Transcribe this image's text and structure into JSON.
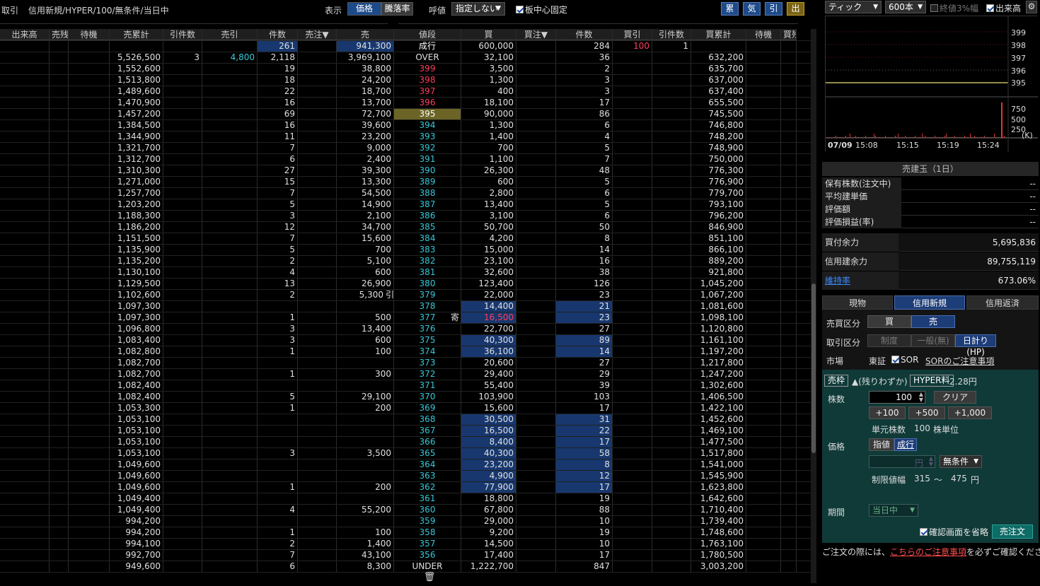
{
  "topbar": {
    "section": "取引",
    "title": "信用新規/HYPER/100/無条件/当日中",
    "display_label": "表示",
    "display_price": "価格",
    "display_rate": "騰落率",
    "tick_label": "呼値",
    "tick_value": "指定しない",
    "center_fix": "板中心固定",
    "btn_cumulative": "累",
    "btn_spirit": "気",
    "btn_pull": "引",
    "btn_exit": "出"
  },
  "book": {
    "headers": [
      "出来高",
      "売残",
      "待機",
      "売累計",
      "引件数",
      "売引",
      "件数",
      "売注▼",
      "売",
      "値段",
      "買",
      "買注▼",
      "件数",
      "買引",
      "引件数",
      "買累計",
      "待機",
      "買残"
    ],
    "summary": {
      "sell_count": "261",
      "sell_qty": "941,300",
      "price": "成行",
      "buy_qty": "600,000",
      "buy_count": "284",
      "buy_pull": "100",
      "buy_pull_count": "1"
    },
    "over": {
      "cum": "5,526,500",
      "pull_count": "3",
      "pull": "4,800",
      "count": "2,118",
      "qty": "3,969,100",
      "price": "OVER",
      "buy": "32,100",
      "bcount": "36",
      "bcum": "632,200"
    },
    "under": {
      "cum": "949,600",
      "count": "6",
      "qty": "8,300",
      "price": "UNDER",
      "buy": "1,222,700",
      "bcount": "847",
      "bcum": "3,003,200"
    },
    "rows": [
      {
        "cum": "1,552,600",
        "cnt": "19",
        "qty": "38,800",
        "p": "399",
        "b": "3,500",
        "bc": "2",
        "bcum": "635,700"
      },
      {
        "cum": "1,513,800",
        "cnt": "18",
        "qty": "24,200",
        "p": "398",
        "b": "1,300",
        "bc": "3",
        "bcum": "637,000"
      },
      {
        "cum": "1,489,600",
        "cnt": "22",
        "qty": "18,700",
        "p": "397",
        "b": "400",
        "bc": "3",
        "bcum": "637,400"
      },
      {
        "cum": "1,470,900",
        "cnt": "16",
        "qty": "13,700",
        "p": "396",
        "b": "18,100",
        "bc": "17",
        "bcum": "655,500"
      },
      {
        "cum": "1,457,200",
        "cnt": "69",
        "qty": "72,700",
        "p": "395",
        "b": "90,000",
        "bc": "86",
        "bcum": "745,500"
      },
      {
        "cum": "1,384,500",
        "cnt": "16",
        "qty": "39,600",
        "p": "394",
        "b": "1,300",
        "bc": "6",
        "bcum": "746,800"
      },
      {
        "cum": "1,344,900",
        "cnt": "11",
        "qty": "23,200",
        "p": "393",
        "b": "1,400",
        "bc": "4",
        "bcum": "748,200"
      },
      {
        "cum": "1,321,700",
        "cnt": "7",
        "qty": "9,000",
        "p": "392",
        "b": "700",
        "bc": "5",
        "bcum": "748,900"
      },
      {
        "cum": "1,312,700",
        "cnt": "6",
        "qty": "2,400",
        "p": "391",
        "b": "1,100",
        "bc": "7",
        "bcum": "750,000"
      },
      {
        "cum": "1,310,300",
        "cnt": "27",
        "qty": "39,300",
        "p": "390",
        "b": "26,300",
        "bc": "48",
        "bcum": "776,300"
      },
      {
        "cum": "1,271,000",
        "cnt": "15",
        "qty": "13,300",
        "p": "389",
        "b": "600",
        "bc": "5",
        "bcum": "776,900"
      },
      {
        "cum": "1,257,700",
        "cnt": "7",
        "qty": "54,500",
        "p": "388",
        "b": "2,800",
        "bc": "6",
        "bcum": "779,700"
      },
      {
        "cum": "1,203,200",
        "cnt": "5",
        "qty": "14,900",
        "p": "387",
        "b": "13,400",
        "bc": "5",
        "bcum": "793,100"
      },
      {
        "cum": "1,188,300",
        "cnt": "3",
        "qty": "2,100",
        "p": "386",
        "b": "3,100",
        "bc": "6",
        "bcum": "796,200"
      },
      {
        "cum": "1,186,200",
        "cnt": "12",
        "qty": "34,700",
        "p": "385",
        "b": "50,700",
        "bc": "50",
        "bcum": "846,900"
      },
      {
        "cum": "1,151,500",
        "cnt": "7",
        "qty": "15,600",
        "p": "384",
        "b": "4,200",
        "bc": "8",
        "bcum": "851,100"
      },
      {
        "cum": "1,135,900",
        "cnt": "5",
        "qty": "700",
        "p": "383",
        "b": "15,000",
        "bc": "14",
        "bcum": "866,100"
      },
      {
        "cum": "1,135,200",
        "cnt": "2",
        "qty": "5,100",
        "p": "382",
        "b": "23,100",
        "bc": "16",
        "bcum": "889,200"
      },
      {
        "cum": "1,130,100",
        "cnt": "4",
        "qty": "600",
        "p": "381",
        "b": "32,600",
        "bc": "38",
        "bcum": "921,800"
      },
      {
        "cum": "1,129,500",
        "cnt": "13",
        "qty": "26,900",
        "p": "380",
        "b": "123,400",
        "bc": "126",
        "bcum": "1,045,200"
      },
      {
        "cum": "1,102,600",
        "cnt": "2",
        "qty": "5,300",
        "mark": "引",
        "p": "379",
        "b": "22,000",
        "bc": "23",
        "bcum": "1,067,200"
      },
      {
        "cum": "1,097,300",
        "cnt": "",
        "qty": "",
        "p": "378",
        "b": "14,400",
        "bc": "21",
        "bcum": "1,081,600",
        "hl": true
      },
      {
        "cum": "1,097,300",
        "cnt": "1",
        "qty": "500",
        "p": "377",
        "bmark": "寄",
        "b": "16,500",
        "bc": "23",
        "bcum": "1,098,100",
        "hl": true,
        "bred": true
      },
      {
        "cum": "1,096,800",
        "cnt": "3",
        "qty": "13,400",
        "p": "376",
        "b": "22,700",
        "bc": "27",
        "bcum": "1,120,800"
      },
      {
        "cum": "1,083,400",
        "cnt": "3",
        "qty": "600",
        "p": "375",
        "b": "40,300",
        "bc": "89",
        "bcum": "1,161,100",
        "hl": true
      },
      {
        "cum": "1,082,800",
        "cnt": "1",
        "qty": "100",
        "p": "374",
        "b": "36,100",
        "bc": "14",
        "bcum": "1,197,200",
        "hl": true
      },
      {
        "cum": "1,082,700",
        "cnt": "",
        "qty": "",
        "p": "373",
        "b": "20,600",
        "bc": "27",
        "bcum": "1,217,800"
      },
      {
        "cum": "1,082,700",
        "cnt": "1",
        "qty": "300",
        "p": "372",
        "b": "29,400",
        "bc": "29",
        "bcum": "1,247,200"
      },
      {
        "cum": "1,082,400",
        "cnt": "",
        "qty": "",
        "p": "371",
        "b": "55,400",
        "bc": "39",
        "bcum": "1,302,600"
      },
      {
        "cum": "1,082,400",
        "cnt": "5",
        "qty": "29,100",
        "p": "370",
        "b": "103,900",
        "bc": "103",
        "bcum": "1,406,500"
      },
      {
        "cum": "1,053,300",
        "cnt": "1",
        "qty": "200",
        "p": "369",
        "b": "15,600",
        "bc": "17",
        "bcum": "1,422,100"
      },
      {
        "cum": "1,053,100",
        "cnt": "",
        "qty": "",
        "p": "368",
        "b": "30,500",
        "bc": "31",
        "bcum": "1,452,600",
        "hl": true
      },
      {
        "cum": "1,053,100",
        "cnt": "",
        "qty": "",
        "p": "367",
        "b": "16,500",
        "bc": "22",
        "bcum": "1,469,100",
        "hl": true
      },
      {
        "cum": "1,053,100",
        "cnt": "",
        "qty": "",
        "p": "366",
        "b": "8,400",
        "bc": "17",
        "bcum": "1,477,500",
        "hl": true
      },
      {
        "cum": "1,053,100",
        "cnt": "3",
        "qty": "3,500",
        "p": "365",
        "b": "40,300",
        "bc": "58",
        "bcum": "1,517,800",
        "hl": true
      },
      {
        "cum": "1,049,600",
        "cnt": "",
        "qty": "",
        "p": "364",
        "b": "23,200",
        "bc": "8",
        "bcum": "1,541,000",
        "hl": true
      },
      {
        "cum": "1,049,600",
        "cnt": "",
        "qty": "",
        "p": "363",
        "b": "4,900",
        "bc": "12",
        "bcum": "1,545,900",
        "hl": true
      },
      {
        "cum": "1,049,600",
        "cnt": "1",
        "qty": "200",
        "p": "362",
        "b": "77,900",
        "bc": "17",
        "bcum": "1,623,800",
        "hl": true
      },
      {
        "cum": "1,049,400",
        "cnt": "",
        "qty": "",
        "p": "361",
        "b": "18,800",
        "bc": "19",
        "bcum": "1,642,600"
      },
      {
        "cum": "1,049,400",
        "cnt": "4",
        "qty": "55,200",
        "p": "360",
        "b": "67,800",
        "bc": "88",
        "bcum": "1,710,400"
      },
      {
        "cum": "994,200",
        "cnt": "",
        "qty": "",
        "p": "359",
        "b": "29,000",
        "bc": "10",
        "bcum": "1,739,400"
      },
      {
        "cum": "994,200",
        "cnt": "1",
        "qty": "100",
        "p": "358",
        "b": "9,200",
        "bc": "19",
        "bcum": "1,748,600"
      },
      {
        "cum": "994,100",
        "cnt": "2",
        "qty": "1,400",
        "p": "357",
        "b": "14,500",
        "bc": "10",
        "bcum": "1,763,100"
      },
      {
        "cum": "992,700",
        "cnt": "7",
        "qty": "43,100",
        "p": "356",
        "b": "17,400",
        "bc": "17",
        "bcum": "1,780,500"
      }
    ],
    "current_price": "395",
    "trash_icon": "trash-icon"
  },
  "right": {
    "chart_type": "ティック",
    "chart_count": "600本",
    "chk_3pct": "終値3%幅",
    "chk_volume": "出来高",
    "price_ticks": [
      "399",
      "398",
      "397",
      "396",
      "395"
    ],
    "vol_ticks": [
      "750",
      "500",
      "250"
    ],
    "vol_unit": "(K)",
    "time_labels": [
      "07/09",
      "15:08",
      "15:15",
      "15:19",
      "15:24"
    ],
    "pos_title": "売建玉（1日）",
    "pos_rows": [
      {
        "k": "保有株数(注文中)",
        "v": "--"
      },
      {
        "k": "平均建単価",
        "v": "--"
      },
      {
        "k": "評価額",
        "v": "--"
      },
      {
        "k": "評価損益(率)",
        "v": "--"
      }
    ],
    "power_rows": [
      {
        "k": "買付余力",
        "v": "5,695,836"
      },
      {
        "k": "信用建余力",
        "v": "89,755,119"
      },
      {
        "k": "維持率",
        "v": "673.06%"
      }
    ],
    "tabs": [
      "現物",
      "信用新規",
      "信用返済"
    ],
    "order": {
      "side_label": "売買区分",
      "buy": "買",
      "sell": "売",
      "kind_label": "取引区分",
      "kind1": "制度",
      "kind2": "一般(無)",
      "kind3": "日計り(HP)",
      "market_label": "市場",
      "market": "東証",
      "sor": "SOR",
      "sor_note": "SORのご注意事項",
      "sell_frame": "売枠",
      "remain": "▲(残りわずか)",
      "hyper_fee": "HYPER料",
      "fee": "2.28円",
      "qty_label": "株数",
      "qty_value": "100",
      "clear": "クリア",
      "plus100": "+100",
      "plus500": "+500",
      "plus1000": "+1,000",
      "unit_label": "単元株数",
      "unit_value": "100",
      "unit_suffix": "株単位",
      "price_label": "価格",
      "limit": "指値",
      "market_order": "成行",
      "yen": "円",
      "cond": "無条件",
      "range_label": "制限値幅",
      "range_low": "315",
      "range_sep": "～",
      "range_high": "475",
      "range_unit": "円",
      "period_label": "期間",
      "period": "当日中",
      "skip_confirm": "確認画面を省略",
      "submit": "売注文"
    },
    "footer_pre": "ご注文の際には、",
    "footer_link": "こちらのご注意事項",
    "footer_post": "を必ずご確認ください。"
  }
}
